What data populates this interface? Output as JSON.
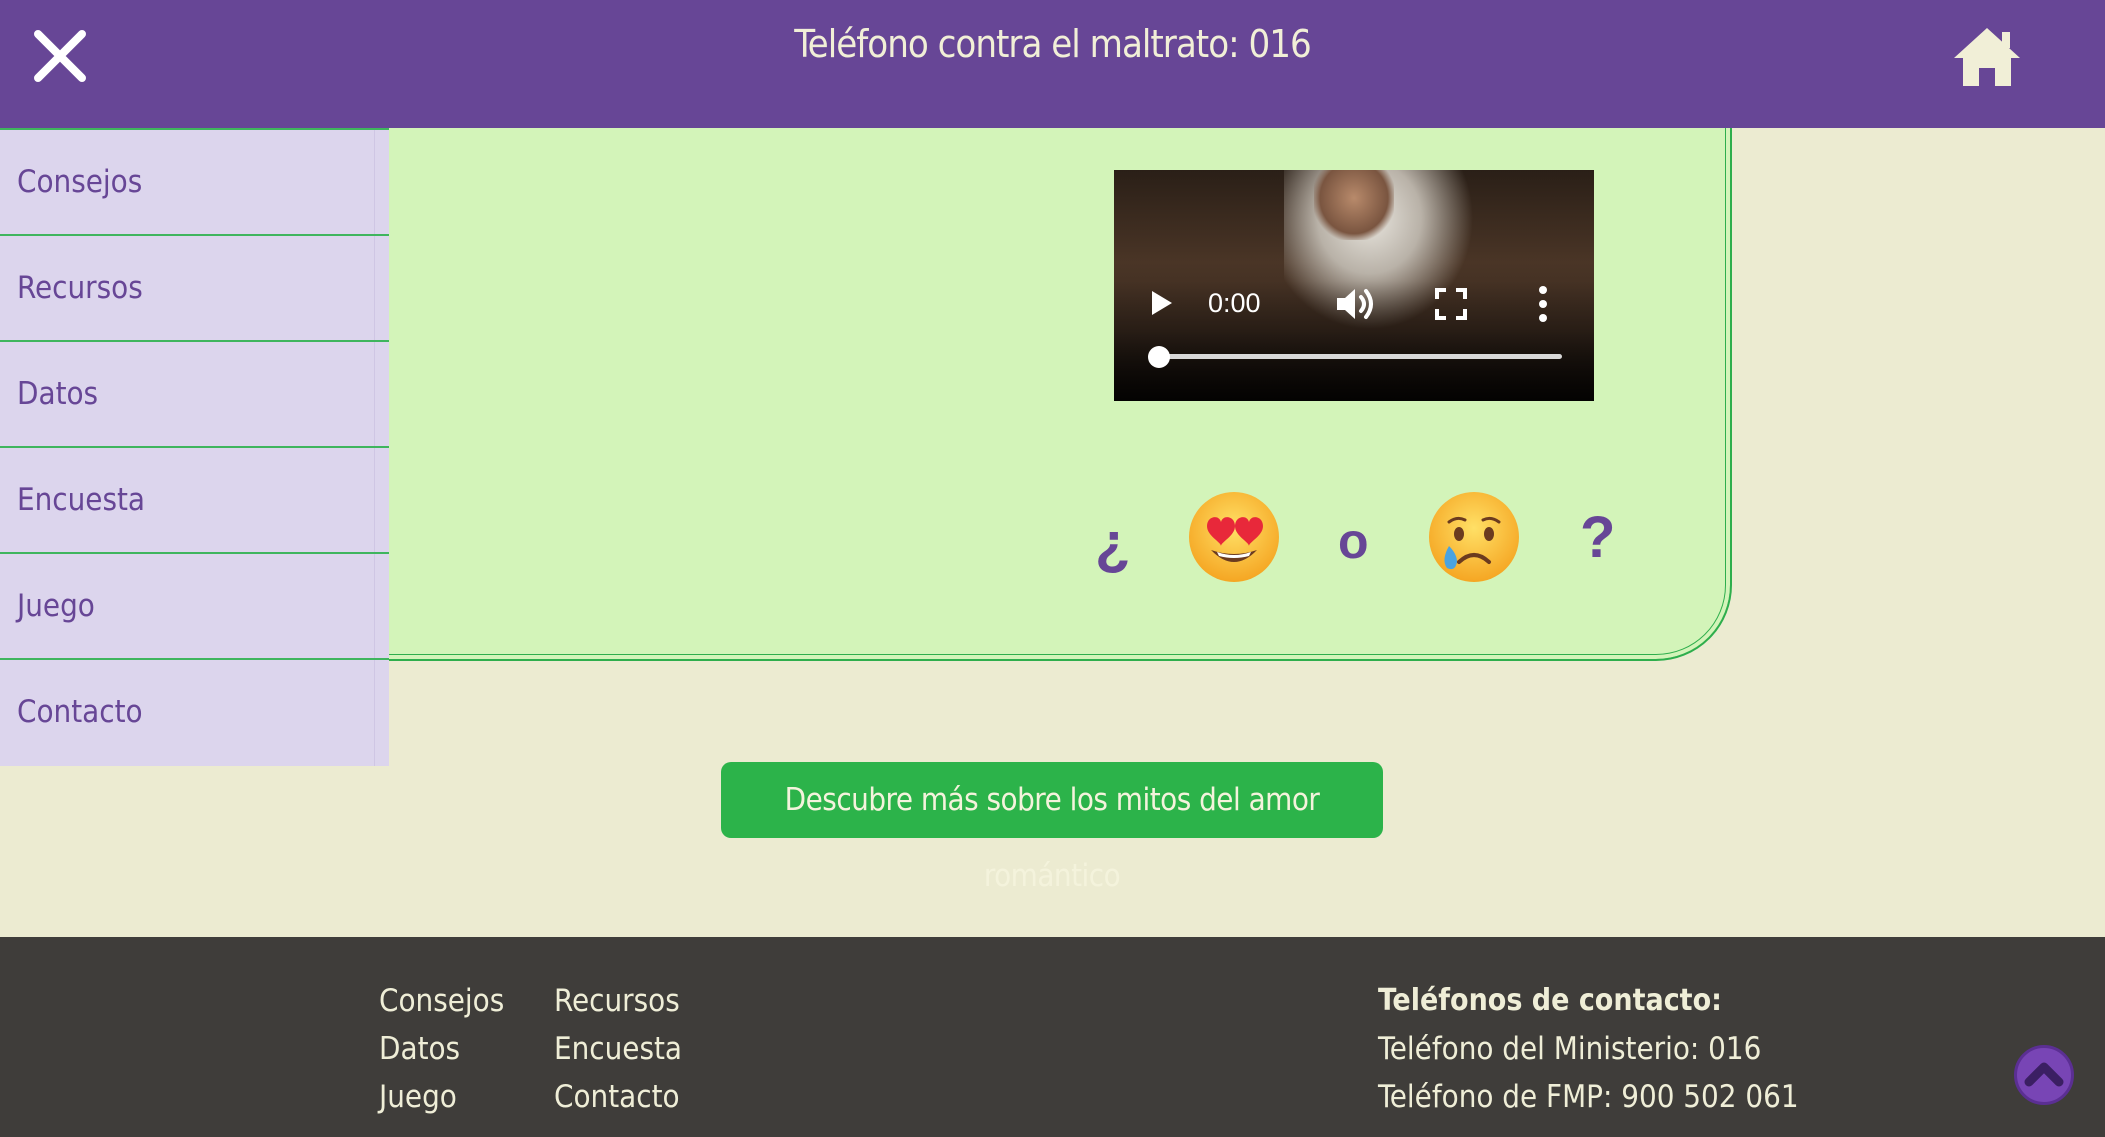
{
  "header": {
    "title": "Teléfono contra el maltrato: 016",
    "close_icon": "close-icon",
    "home_icon": "home-icon"
  },
  "sidebar": {
    "items": [
      {
        "label": "Consejos"
      },
      {
        "label": "Recursos"
      },
      {
        "label": "Datos"
      },
      {
        "label": "Encuesta"
      },
      {
        "label": "Juego"
      },
      {
        "label": "Contacto"
      }
    ]
  },
  "video": {
    "time": "0:00",
    "progress": 0,
    "icons": [
      "play-icon",
      "volume-icon",
      "fullscreen-icon",
      "more-options-icon"
    ]
  },
  "question": {
    "open": "¿",
    "or": "o",
    "close": "?",
    "emoji_1": "heart-eyes-emoji",
    "emoji_2": "crying-face-emoji"
  },
  "cta": {
    "label": "Descubre más sobre los mitos del amor romántico"
  },
  "footer": {
    "links": [
      "Consejos",
      "Recursos",
      "Datos",
      "Encuesta",
      "Juego",
      "Contacto"
    ],
    "contact_heading": "Teléfonos de contacto:",
    "contact_lines": [
      "Teléfono del Ministerio: 016",
      "Teléfono de FMP: 900 502 061"
    ],
    "to_top_icon": "chevron-up-icon"
  },
  "colors": {
    "header_bg": "#674696",
    "page_bg": "#ecebd1",
    "card_bg": "#d3f4b9",
    "accent_green": "#2cb34a",
    "sidebar_bg": "#dcd5ed",
    "footer_bg": "#3f3d3a"
  }
}
